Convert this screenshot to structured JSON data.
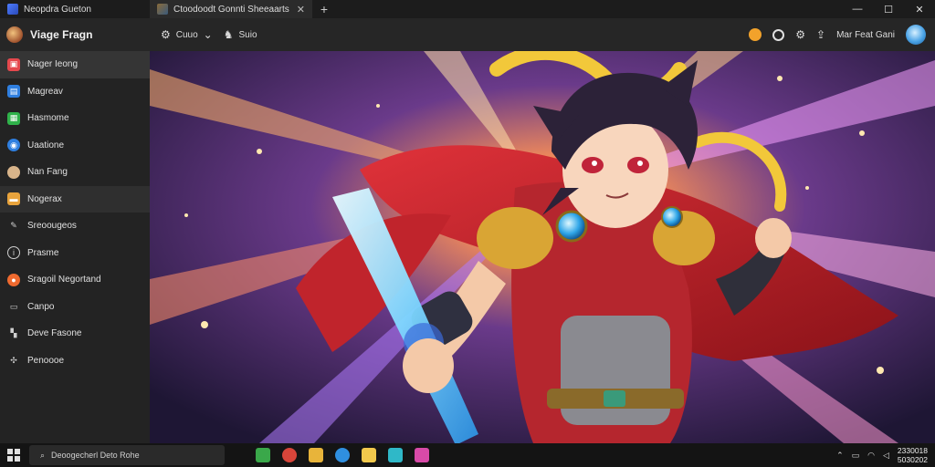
{
  "window": {
    "app_title": "Neopdra Gueton",
    "tab_title": "Ctoodoodt Gonnti Sheeaarts",
    "tab_close": "✕",
    "new_tab": "+",
    "minimize": "—",
    "maximize": "☐",
    "close": "✕"
  },
  "toolbar": {
    "profile_name": "Viage Fragn",
    "tool1_label": "Cuuo",
    "tool2_label": "Suio",
    "account_label": "Mar Feat Gani"
  },
  "sidebar": {
    "items": [
      {
        "label": "Nager Ieong",
        "icon": "image-icon",
        "color": "#e5484d"
      },
      {
        "label": "Magreav",
        "icon": "gallery-icon",
        "color": "#2f7fe0"
      },
      {
        "label": "Hasmome",
        "icon": "grid-icon",
        "color": "#2fb24a"
      },
      {
        "label": "Uaatione",
        "icon": "globe-icon",
        "color": "#2f7fe0"
      },
      {
        "label": "Nan Fang",
        "icon": "avatar-icon",
        "color": "#d8b48a"
      },
      {
        "label": "Nogerax",
        "icon": "folder-icon",
        "color": "#e8a33c"
      },
      {
        "label": "Sreoougeos",
        "icon": "brush-icon",
        "color": "#cfcfcf"
      },
      {
        "label": "Prasme",
        "icon": "info-icon",
        "color": "#cfcfcf"
      },
      {
        "label": "Sragoil Negortand",
        "icon": "record-icon",
        "color": "#ef6a2f"
      },
      {
        "label": "Canpo",
        "icon": "chat-icon",
        "color": "#cfcfcf"
      },
      {
        "label": "Deve Fasone",
        "icon": "apps-icon",
        "color": "#cfcfcf"
      },
      {
        "label": "Penoooe",
        "icon": "network-icon",
        "color": "#cfcfcf"
      }
    ]
  },
  "taskbar": {
    "search_text": "Deoogecherl Deto Rohe",
    "time": "2330018",
    "date": "5030202"
  }
}
